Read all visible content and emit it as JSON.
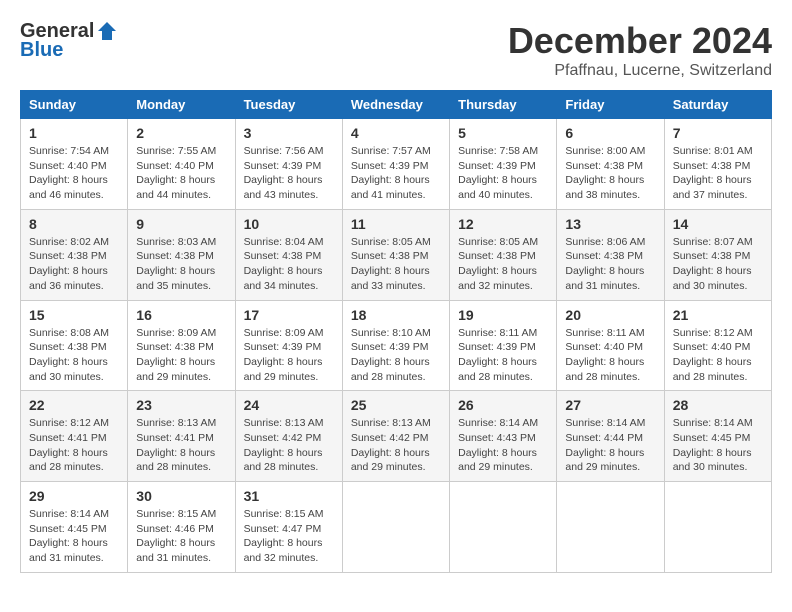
{
  "logo": {
    "general": "General",
    "blue": "Blue",
    "tagline": ""
  },
  "title": "December 2024",
  "subtitle": "Pfaffnau, Lucerne, Switzerland",
  "days_of_week": [
    "Sunday",
    "Monday",
    "Tuesday",
    "Wednesday",
    "Thursday",
    "Friday",
    "Saturday"
  ],
  "weeks": [
    [
      {
        "day": "1",
        "sunrise": "7:54 AM",
        "sunset": "4:40 PM",
        "daylight": "8 hours and 46 minutes."
      },
      {
        "day": "2",
        "sunrise": "7:55 AM",
        "sunset": "4:40 PM",
        "daylight": "8 hours and 44 minutes."
      },
      {
        "day": "3",
        "sunrise": "7:56 AM",
        "sunset": "4:39 PM",
        "daylight": "8 hours and 43 minutes."
      },
      {
        "day": "4",
        "sunrise": "7:57 AM",
        "sunset": "4:39 PM",
        "daylight": "8 hours and 41 minutes."
      },
      {
        "day": "5",
        "sunrise": "7:58 AM",
        "sunset": "4:39 PM",
        "daylight": "8 hours and 40 minutes."
      },
      {
        "day": "6",
        "sunrise": "8:00 AM",
        "sunset": "4:38 PM",
        "daylight": "8 hours and 38 minutes."
      },
      {
        "day": "7",
        "sunrise": "8:01 AM",
        "sunset": "4:38 PM",
        "daylight": "8 hours and 37 minutes."
      }
    ],
    [
      {
        "day": "8",
        "sunrise": "8:02 AM",
        "sunset": "4:38 PM",
        "daylight": "8 hours and 36 minutes."
      },
      {
        "day": "9",
        "sunrise": "8:03 AM",
        "sunset": "4:38 PM",
        "daylight": "8 hours and 35 minutes."
      },
      {
        "day": "10",
        "sunrise": "8:04 AM",
        "sunset": "4:38 PM",
        "daylight": "8 hours and 34 minutes."
      },
      {
        "day": "11",
        "sunrise": "8:05 AM",
        "sunset": "4:38 PM",
        "daylight": "8 hours and 33 minutes."
      },
      {
        "day": "12",
        "sunrise": "8:05 AM",
        "sunset": "4:38 PM",
        "daylight": "8 hours and 32 minutes."
      },
      {
        "day": "13",
        "sunrise": "8:06 AM",
        "sunset": "4:38 PM",
        "daylight": "8 hours and 31 minutes."
      },
      {
        "day": "14",
        "sunrise": "8:07 AM",
        "sunset": "4:38 PM",
        "daylight": "8 hours and 30 minutes."
      }
    ],
    [
      {
        "day": "15",
        "sunrise": "8:08 AM",
        "sunset": "4:38 PM",
        "daylight": "8 hours and 30 minutes."
      },
      {
        "day": "16",
        "sunrise": "8:09 AM",
        "sunset": "4:38 PM",
        "daylight": "8 hours and 29 minutes."
      },
      {
        "day": "17",
        "sunrise": "8:09 AM",
        "sunset": "4:39 PM",
        "daylight": "8 hours and 29 minutes."
      },
      {
        "day": "18",
        "sunrise": "8:10 AM",
        "sunset": "4:39 PM",
        "daylight": "8 hours and 28 minutes."
      },
      {
        "day": "19",
        "sunrise": "8:11 AM",
        "sunset": "4:39 PM",
        "daylight": "8 hours and 28 minutes."
      },
      {
        "day": "20",
        "sunrise": "8:11 AM",
        "sunset": "4:40 PM",
        "daylight": "8 hours and 28 minutes."
      },
      {
        "day": "21",
        "sunrise": "8:12 AM",
        "sunset": "4:40 PM",
        "daylight": "8 hours and 28 minutes."
      }
    ],
    [
      {
        "day": "22",
        "sunrise": "8:12 AM",
        "sunset": "4:41 PM",
        "daylight": "8 hours and 28 minutes."
      },
      {
        "day": "23",
        "sunrise": "8:13 AM",
        "sunset": "4:41 PM",
        "daylight": "8 hours and 28 minutes."
      },
      {
        "day": "24",
        "sunrise": "8:13 AM",
        "sunset": "4:42 PM",
        "daylight": "8 hours and 28 minutes."
      },
      {
        "day": "25",
        "sunrise": "8:13 AM",
        "sunset": "4:42 PM",
        "daylight": "8 hours and 29 minutes."
      },
      {
        "day": "26",
        "sunrise": "8:14 AM",
        "sunset": "4:43 PM",
        "daylight": "8 hours and 29 minutes."
      },
      {
        "day": "27",
        "sunrise": "8:14 AM",
        "sunset": "4:44 PM",
        "daylight": "8 hours and 29 minutes."
      },
      {
        "day": "28",
        "sunrise": "8:14 AM",
        "sunset": "4:45 PM",
        "daylight": "8 hours and 30 minutes."
      }
    ],
    [
      {
        "day": "29",
        "sunrise": "8:14 AM",
        "sunset": "4:45 PM",
        "daylight": "8 hours and 31 minutes."
      },
      {
        "day": "30",
        "sunrise": "8:15 AM",
        "sunset": "4:46 PM",
        "daylight": "8 hours and 31 minutes."
      },
      {
        "day": "31",
        "sunrise": "8:15 AM",
        "sunset": "4:47 PM",
        "daylight": "8 hours and 32 minutes."
      },
      null,
      null,
      null,
      null
    ]
  ],
  "labels": {
    "sunrise": "Sunrise: ",
    "sunset": "Sunset: ",
    "daylight": "Daylight: "
  }
}
